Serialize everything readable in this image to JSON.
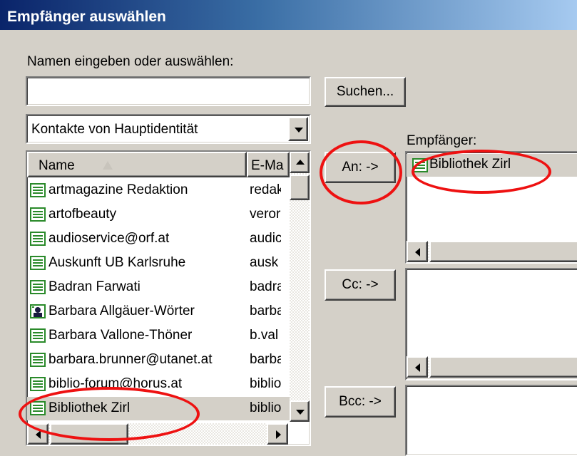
{
  "window": {
    "title": "Empfänger auswählen"
  },
  "search": {
    "label": "Namen eingeben oder auswählen:",
    "value": "",
    "button": "Suchen..."
  },
  "source_select": {
    "value": "Kontakte von Hauptidentität"
  },
  "list": {
    "columns": [
      "Name",
      "E-Ma"
    ],
    "rows": [
      {
        "name": "artmagazine Redaktion",
        "email": "redak",
        "icon": "contact-card-icon"
      },
      {
        "name": "artofbeauty",
        "email": "veror",
        "icon": "contact-card-icon"
      },
      {
        "name": "audioservice@orf.at",
        "email": "audic",
        "icon": "contact-card-icon"
      },
      {
        "name": "Auskunft UB Karlsruhe",
        "email": "ausk",
        "icon": "contact-card-icon"
      },
      {
        "name": "Badran Farwati",
        "email": "badra",
        "icon": "contact-card-icon"
      },
      {
        "name": "Barbara Allgäuer-Wörter",
        "email": "barba",
        "icon": "contact-photo-icon"
      },
      {
        "name": "Barbara Vallone-Thöner",
        "email": "b.val",
        "icon": "contact-card-icon"
      },
      {
        "name": "barbara.brunner@utanet.at",
        "email": "barba",
        "icon": "contact-card-icon"
      },
      {
        "name": "biblio-forum@horus.at",
        "email": "biblio",
        "icon": "contact-card-icon"
      },
      {
        "name": "Bibliothek Zirl",
        "email": "biblio",
        "icon": "contact-card-icon",
        "selected": true
      }
    ]
  },
  "buttons": {
    "to": "An: ->",
    "cc": "Cc: ->",
    "bcc": "Bcc: ->"
  },
  "recipients": {
    "label": "Empfänger:",
    "to": [
      "Bibliothek Zirl"
    ],
    "cc": [],
    "bcc": []
  },
  "colors": {
    "title_start": "#0a246a",
    "title_end": "#a6caf0",
    "annotation": "#ee1111",
    "card_green": "#2a8a2a"
  }
}
